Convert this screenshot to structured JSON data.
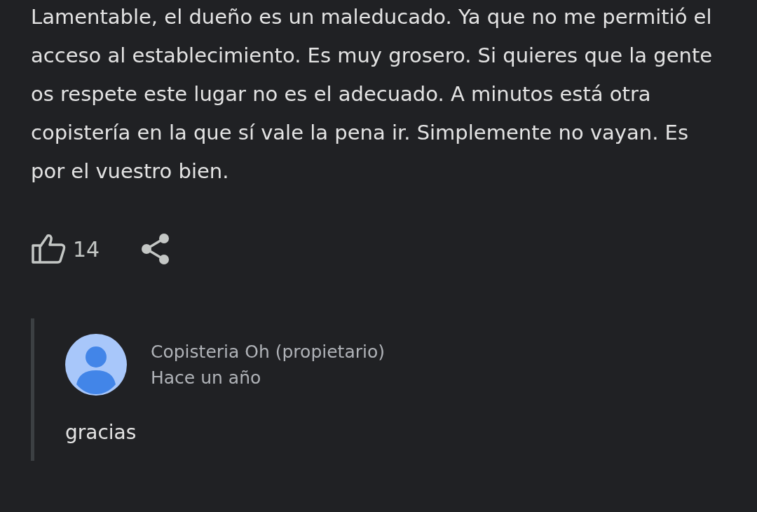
{
  "review": {
    "text": "Lamentable, el dueño es un maleducado. Ya que no me permitió el acceso al establecimiento. Es muy grosero. Si quieres que la gente os respete este lugar no es el adecuado. A minutos está otra copistería en la que sí vale la pena ir. Simplemente no vayan. Es por el vuestro bien.",
    "likes": "14"
  },
  "reply": {
    "author": "Copisteria Oh (propietario)",
    "time": "Hace un año",
    "text": "gracias"
  }
}
